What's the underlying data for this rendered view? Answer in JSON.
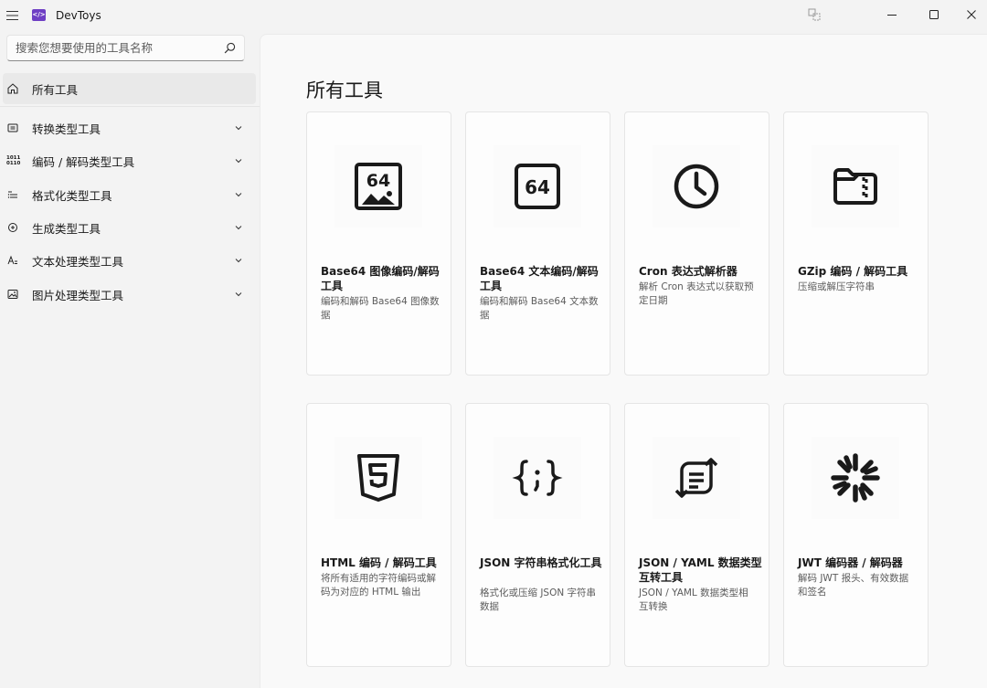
{
  "app": {
    "title": "DevToys",
    "logo_text": "</>"
  },
  "window_controls": {
    "compact": "compact-overlay-icon",
    "minimize": "minimize-icon",
    "maximize": "maximize-icon",
    "close": "close-icon"
  },
  "search": {
    "placeholder": "搜索您想要使用的工具名称"
  },
  "sidebar": {
    "items": [
      {
        "label": "所有工具",
        "icon": "home-icon",
        "selected": true
      },
      {
        "label": "转换类型工具",
        "icon": "converter-icon"
      },
      {
        "label": "编码 / 解码类型工具",
        "icon": "binary-icon"
      },
      {
        "label": "格式化类型工具",
        "icon": "formatter-icon"
      },
      {
        "label": "生成类型工具",
        "icon": "generator-icon"
      },
      {
        "label": "文本处理类型工具",
        "icon": "text-icon"
      },
      {
        "label": "图片处理类型工具",
        "icon": "image-icon"
      }
    ]
  },
  "main": {
    "title": "所有工具",
    "cards": [
      {
        "title": "Base64 图像编码/解码工具",
        "desc": "编码和解码 Base64 图像数据",
        "icon": "base64-image-icon"
      },
      {
        "title": "Base64 文本编码/解码工具",
        "desc": "编码和解码 Base64 文本数据",
        "icon": "base64-text-icon"
      },
      {
        "title": "Cron 表达式解析器",
        "desc": "解析 Cron 表达式以获取预定日期",
        "icon": "clock-icon"
      },
      {
        "title": "GZip 编码 / 解码工具",
        "desc": "压缩或解压字符串",
        "icon": "zip-folder-icon"
      },
      {
        "title": "HTML 编码 / 解码工具",
        "desc": "将所有适用的字符编码或解码为对应的 HTML 输出",
        "icon": "html5-icon"
      },
      {
        "title": "JSON 字符串格式化工具",
        "desc": "格式化或压缩 JSON 字符串数据",
        "icon": "braces-icon"
      },
      {
        "title": "JSON / YAML 数据类型互转工具",
        "desc": "JSON / YAML 数据类型相互转换",
        "icon": "swap-lines-icon"
      },
      {
        "title": "JWT 编码器 / 解码器",
        "desc": "解码 JWT 报头、有效数据和签名",
        "icon": "jwt-icon"
      }
    ]
  }
}
